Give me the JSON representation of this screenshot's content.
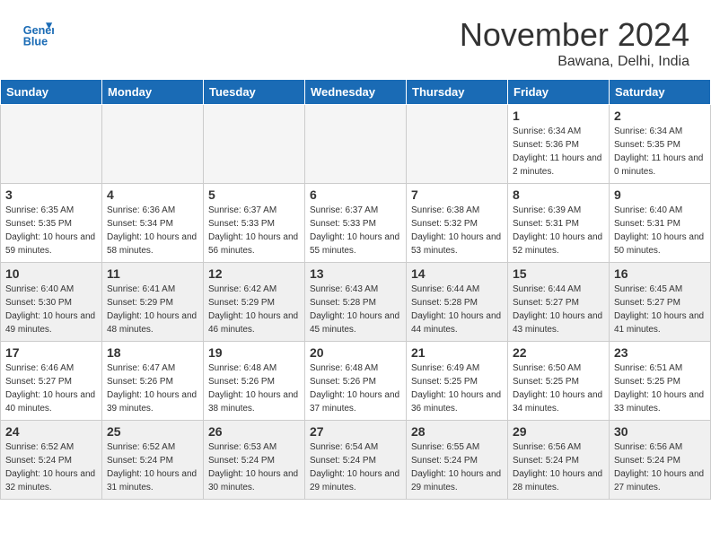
{
  "header": {
    "logo_line1": "General",
    "logo_line2": "Blue",
    "month": "November 2024",
    "location": "Bawana, Delhi, India"
  },
  "weekdays": [
    "Sunday",
    "Monday",
    "Tuesday",
    "Wednesday",
    "Thursday",
    "Friday",
    "Saturday"
  ],
  "weeks": [
    [
      {
        "day": "",
        "empty": true
      },
      {
        "day": "",
        "empty": true
      },
      {
        "day": "",
        "empty": true
      },
      {
        "day": "",
        "empty": true
      },
      {
        "day": "",
        "empty": true
      },
      {
        "day": "1",
        "sunrise": "6:34 AM",
        "sunset": "5:36 PM",
        "daylight": "11 hours and 2 minutes."
      },
      {
        "day": "2",
        "sunrise": "6:34 AM",
        "sunset": "5:35 PM",
        "daylight": "11 hours and 0 minutes."
      }
    ],
    [
      {
        "day": "3",
        "sunrise": "6:35 AM",
        "sunset": "5:35 PM",
        "daylight": "10 hours and 59 minutes."
      },
      {
        "day": "4",
        "sunrise": "6:36 AM",
        "sunset": "5:34 PM",
        "daylight": "10 hours and 58 minutes."
      },
      {
        "day": "5",
        "sunrise": "6:37 AM",
        "sunset": "5:33 PM",
        "daylight": "10 hours and 56 minutes."
      },
      {
        "day": "6",
        "sunrise": "6:37 AM",
        "sunset": "5:33 PM",
        "daylight": "10 hours and 55 minutes."
      },
      {
        "day": "7",
        "sunrise": "6:38 AM",
        "sunset": "5:32 PM",
        "daylight": "10 hours and 53 minutes."
      },
      {
        "day": "8",
        "sunrise": "6:39 AM",
        "sunset": "5:31 PM",
        "daylight": "10 hours and 52 minutes."
      },
      {
        "day": "9",
        "sunrise": "6:40 AM",
        "sunset": "5:31 PM",
        "daylight": "10 hours and 50 minutes."
      }
    ],
    [
      {
        "day": "10",
        "sunrise": "6:40 AM",
        "sunset": "5:30 PM",
        "daylight": "10 hours and 49 minutes."
      },
      {
        "day": "11",
        "sunrise": "6:41 AM",
        "sunset": "5:29 PM",
        "daylight": "10 hours and 48 minutes."
      },
      {
        "day": "12",
        "sunrise": "6:42 AM",
        "sunset": "5:29 PM",
        "daylight": "10 hours and 46 minutes."
      },
      {
        "day": "13",
        "sunrise": "6:43 AM",
        "sunset": "5:28 PM",
        "daylight": "10 hours and 45 minutes."
      },
      {
        "day": "14",
        "sunrise": "6:44 AM",
        "sunset": "5:28 PM",
        "daylight": "10 hours and 44 minutes."
      },
      {
        "day": "15",
        "sunrise": "6:44 AM",
        "sunset": "5:27 PM",
        "daylight": "10 hours and 43 minutes."
      },
      {
        "day": "16",
        "sunrise": "6:45 AM",
        "sunset": "5:27 PM",
        "daylight": "10 hours and 41 minutes."
      }
    ],
    [
      {
        "day": "17",
        "sunrise": "6:46 AM",
        "sunset": "5:27 PM",
        "daylight": "10 hours and 40 minutes."
      },
      {
        "day": "18",
        "sunrise": "6:47 AM",
        "sunset": "5:26 PM",
        "daylight": "10 hours and 39 minutes."
      },
      {
        "day": "19",
        "sunrise": "6:48 AM",
        "sunset": "5:26 PM",
        "daylight": "10 hours and 38 minutes."
      },
      {
        "day": "20",
        "sunrise": "6:48 AM",
        "sunset": "5:26 PM",
        "daylight": "10 hours and 37 minutes."
      },
      {
        "day": "21",
        "sunrise": "6:49 AM",
        "sunset": "5:25 PM",
        "daylight": "10 hours and 36 minutes."
      },
      {
        "day": "22",
        "sunrise": "6:50 AM",
        "sunset": "5:25 PM",
        "daylight": "10 hours and 34 minutes."
      },
      {
        "day": "23",
        "sunrise": "6:51 AM",
        "sunset": "5:25 PM",
        "daylight": "10 hours and 33 minutes."
      }
    ],
    [
      {
        "day": "24",
        "sunrise": "6:52 AM",
        "sunset": "5:24 PM",
        "daylight": "10 hours and 32 minutes."
      },
      {
        "day": "25",
        "sunrise": "6:52 AM",
        "sunset": "5:24 PM",
        "daylight": "10 hours and 31 minutes."
      },
      {
        "day": "26",
        "sunrise": "6:53 AM",
        "sunset": "5:24 PM",
        "daylight": "10 hours and 30 minutes."
      },
      {
        "day": "27",
        "sunrise": "6:54 AM",
        "sunset": "5:24 PM",
        "daylight": "10 hours and 29 minutes."
      },
      {
        "day": "28",
        "sunrise": "6:55 AM",
        "sunset": "5:24 PM",
        "daylight": "10 hours and 29 minutes."
      },
      {
        "day": "29",
        "sunrise": "6:56 AM",
        "sunset": "5:24 PM",
        "daylight": "10 hours and 28 minutes."
      },
      {
        "day": "30",
        "sunrise": "6:56 AM",
        "sunset": "5:24 PM",
        "daylight": "10 hours and 27 minutes."
      }
    ]
  ]
}
